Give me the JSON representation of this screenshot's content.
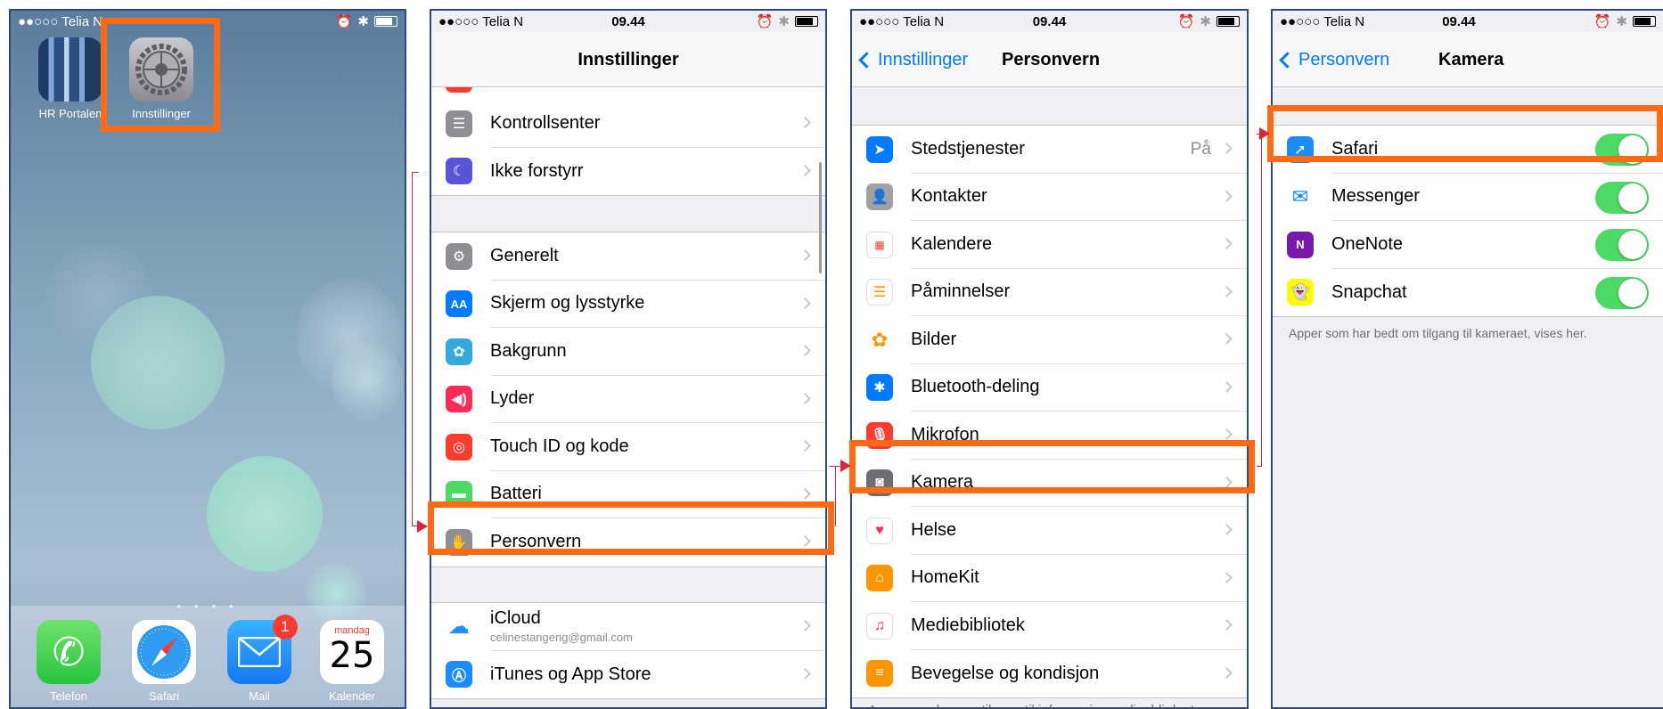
{
  "colors": {
    "highlight": "#ff6a13",
    "ios_blue": "#007aff",
    "toggle_on": "#4cd964",
    "connector": "#d9263b"
  },
  "panel1": {
    "status": {
      "carrier": "●●○○○ Telia N",
      "time": "09.44"
    },
    "apps": [
      {
        "label": "HR Portalen",
        "icon": "hr-portal-icon"
      },
      {
        "label": "Innstillinger",
        "icon": "settings-gear-icon"
      }
    ],
    "page_dots": "• • • •",
    "dock": [
      {
        "label": "Telefon",
        "icon": "phone-icon"
      },
      {
        "label": "Safari",
        "icon": "safari-compass-icon"
      },
      {
        "label": "Mail",
        "icon": "mail-icon",
        "badge": "1"
      },
      {
        "label": "Kalender",
        "icon": "calendar-icon",
        "weekday": "mandag",
        "day": "25"
      }
    ]
  },
  "panel2": {
    "status": {
      "carrier": "●●○○○ Telia N",
      "time": "09.44"
    },
    "title": "Innstillinger",
    "group1": [
      {
        "label": "Kontrollsenter",
        "icon": "control-center-icon",
        "color": "#8e8e93"
      },
      {
        "label": "Ikke forstyrr",
        "icon": "moon-icon",
        "color": "#5856d6"
      }
    ],
    "group2": [
      {
        "label": "Generelt",
        "icon": "gear-icon",
        "color": "#8e8e93"
      },
      {
        "label": "Skjerm og lysstyrke",
        "icon": "text-size-icon",
        "color": "#007aff"
      },
      {
        "label": "Bakgrunn",
        "icon": "wallpaper-flower-icon",
        "color": "#34aadc"
      },
      {
        "label": "Lyder",
        "icon": "speaker-icon",
        "color": "#ff2d55"
      },
      {
        "label": "Touch ID og kode",
        "icon": "fingerprint-icon",
        "color": "#ff3b30"
      },
      {
        "label": "Batteri",
        "icon": "battery-icon",
        "color": "#4cd964"
      },
      {
        "label": "Personvern",
        "icon": "hand-icon",
        "color": "#8e8e93"
      }
    ],
    "group3": [
      {
        "label": "iCloud",
        "sub": "celinestangeng@gmail.com",
        "icon": "cloud-icon",
        "color": "#1e90ff"
      },
      {
        "label": "iTunes og App Store",
        "icon": "app-store-icon",
        "color": "#1a8cff"
      }
    ]
  },
  "panel3": {
    "status": {
      "carrier": "●●○○○ Telia N",
      "time": "09.44"
    },
    "back": "Innstillinger",
    "title": "Personvern",
    "rows": [
      {
        "label": "Stedstjenester",
        "value": "På",
        "icon": "location-arrow-icon",
        "color": "#007aff"
      },
      {
        "label": "Kontakter",
        "icon": "contacts-icon",
        "color": "#a0a0a5"
      },
      {
        "label": "Kalendere",
        "icon": "calendar-icon",
        "color": "#ff3b30"
      },
      {
        "label": "Påminnelser",
        "icon": "reminders-icon",
        "color": "#ff9500"
      },
      {
        "label": "Bilder",
        "icon": "photos-icon",
        "color": "#ffcc00"
      },
      {
        "label": "Bluetooth-deling",
        "icon": "bluetooth-icon",
        "color": "#007aff"
      },
      {
        "label": "Mikrofon",
        "icon": "microphone-icon",
        "color": "#ff3b30"
      },
      {
        "label": "Kamera",
        "icon": "camera-icon",
        "color": "#6d6d72"
      },
      {
        "label": "Helse",
        "icon": "heart-icon",
        "color": "#ff2d55"
      },
      {
        "label": "HomeKit",
        "icon": "home-icon",
        "color": "#ff9500"
      },
      {
        "label": "Mediebibliotek",
        "icon": "music-note-icon",
        "color": "#ff2d55"
      },
      {
        "label": "Bevegelse og kondisjon",
        "icon": "motion-icon",
        "color": "#ff9500"
      }
    ],
    "footer": "Apper som ber om tilgang til informasjonen din, blir lagt"
  },
  "panel4": {
    "status": {
      "carrier": "●●○○○ Telia N",
      "time": "09.44"
    },
    "back": "Personvern",
    "title": "Kamera",
    "rows": [
      {
        "label": "Safari",
        "icon": "safari-compass-icon",
        "color": "#1a8cff",
        "on": true
      },
      {
        "label": "Messenger",
        "icon": "messenger-icon",
        "color": "#0084ff",
        "on": true
      },
      {
        "label": "OneNote",
        "icon": "onenote-icon",
        "color": "#7719aa",
        "on": true
      },
      {
        "label": "Snapchat",
        "icon": "snapchat-ghost-icon",
        "color": "#fffc00",
        "on": true
      }
    ],
    "footer": "Apper som har bedt om tilgang til kameraet, vises her."
  }
}
